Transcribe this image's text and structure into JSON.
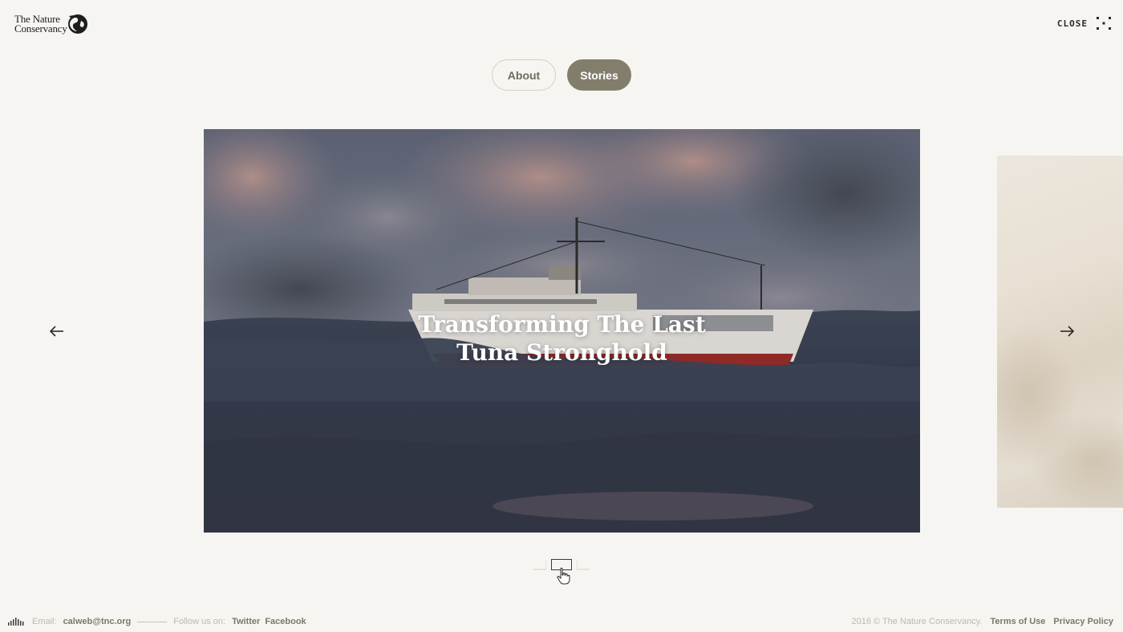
{
  "header": {
    "logo_line1": "The Nature",
    "logo_line2": "Conservancy",
    "close_label": "CLOSE"
  },
  "tabs": [
    {
      "label": "About",
      "active": false
    },
    {
      "label": "Stories",
      "active": true
    }
  ],
  "carousel": {
    "current_slide": {
      "title_line1": "Transforming The Last",
      "title_line2": "Tuna Stronghold",
      "image": "fishing boat on ocean waves at dusk"
    },
    "next_slide_image": "pale grassland",
    "prev_icon": "arrow-left-icon",
    "next_icon": "arrow-right-icon",
    "pager": {
      "total": 3,
      "current": 2
    }
  },
  "footer": {
    "email_label": "Email:",
    "email": "calweb@tnc.org",
    "follow_label": "Follow us on:",
    "twitter": "Twitter",
    "facebook": "Facebook",
    "copyright": "2016 © The Nature Conservancy.",
    "terms": "Terms of Use",
    "privacy": "Privacy Policy"
  },
  "colors": {
    "background": "#f6f5f1",
    "accent": "#837e6b",
    "text": "#6e6a5f"
  }
}
